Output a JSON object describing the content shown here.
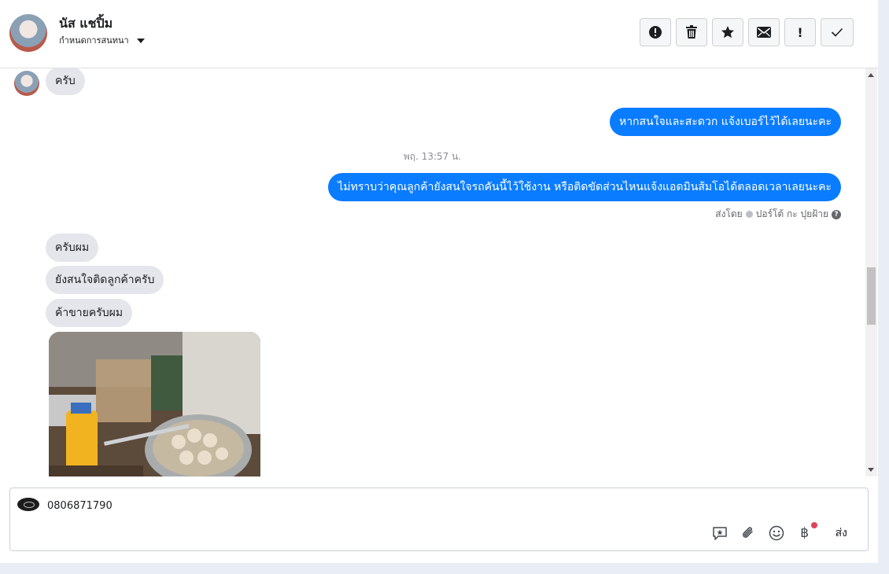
{
  "contact": {
    "name": "นัส แชปิ้ม",
    "label_action": "กำหนดการสนทนา"
  },
  "toolbar": {
    "actions": [
      {
        "icon": "alert-circle-icon",
        "text": ""
      },
      {
        "icon": "trash-icon",
        "text": ""
      },
      {
        "icon": "star-icon",
        "text": ""
      },
      {
        "icon": "envelope-icon",
        "text": ""
      },
      {
        "icon": "exclamation-icon",
        "text": "!"
      },
      {
        "icon": "check-icon",
        "text": ""
      }
    ]
  },
  "messages": {
    "m1": "ครับ",
    "m2": "หากสนใจและสะดวก แจ้งเบอร์ไว้ได้เลยนะคะ",
    "timestamp": "พฤ. 13:57 น.",
    "m3": "ไม่ทราบว่าคุณลูกค้ายังสนใจรถคันนี้ไว้ใช้งาน หรือติดขัดส่วนไหนแจ้งแอดมินส้มโอได้ตลอดเวลาเลยนะคะ",
    "sent_by_prefix": "ส่งโดย",
    "sent_by_name": "ปอร์โต้ กะ ปุยฝ้าย",
    "help": "?",
    "m4": "ครับผม",
    "m5": "ยังสนใจติดลูกค้าครับ",
    "m6": "ค้าขายครับผม"
  },
  "composer": {
    "value": "0806871790",
    "baht_symbol": "฿",
    "send_label": "ส่ง"
  },
  "colors": {
    "outgoing_bubble": "#0a7cff",
    "incoming_bubble": "#e4e6eb",
    "notification_dot": "#e0445a"
  }
}
